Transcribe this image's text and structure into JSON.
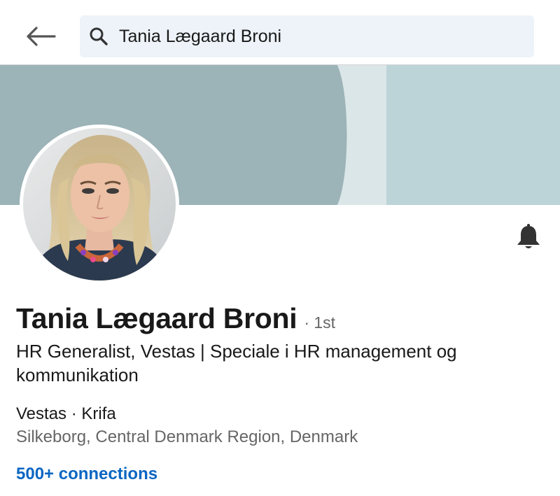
{
  "search": {
    "value": "Tania Lægaard Broni",
    "icon": "search-icon"
  },
  "nav": {
    "back_icon": "back-arrow-icon"
  },
  "colors": {
    "accent": "#0a66c2",
    "cover_dark": "#9cb3b7",
    "cover_light": "#bcd4d8",
    "text_primary": "#191919",
    "text_secondary": "#666666"
  },
  "profile": {
    "name": "Tania Lægaard Broni",
    "degree": "· 1st",
    "headline": "HR Generalist, Vestas | Speciale i HR management og kommunikation",
    "companies": "Vestas · Krifa",
    "location": "Silkeborg, Central Denmark Region, Denmark",
    "connections": "500+ connections",
    "notify_icon": "bell-icon"
  }
}
